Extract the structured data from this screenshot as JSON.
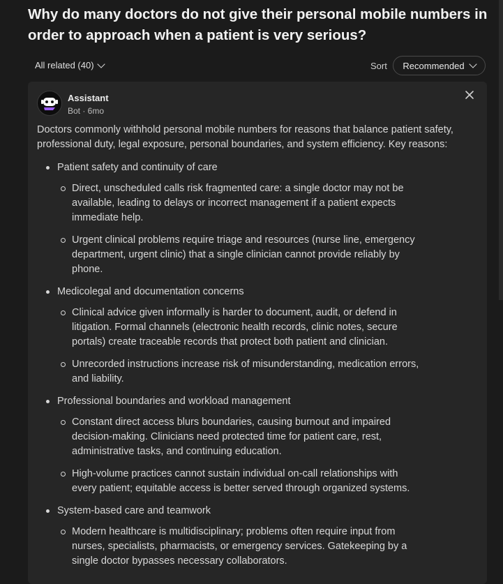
{
  "question": {
    "title": "Why do many doctors do not give their personal mobile numbers in order to approach when a patient is very serious?"
  },
  "filter": {
    "all_related_label": "All related (40)",
    "sort_label": "Sort",
    "sort_value": "Recommended"
  },
  "answer": {
    "author": "Assistant",
    "meta": "Bot · 6mo",
    "intro": "Doctors commonly withhold personal mobile numbers for reasons that balance patient safety, professional duty, legal exposure, personal boundaries, and system efficiency. Key reasons:",
    "sections": [
      {
        "title": "Patient safety and continuity of care",
        "points": [
          "Direct, unscheduled calls risk fragmented care: a single doctor may not be available, leading to delays or incorrect management if a patient expects immediate help.",
          "Urgent clinical problems require triage and resources (nurse line, emergency department, urgent clinic) that a single clinician cannot provide reliably by phone."
        ]
      },
      {
        "title": "Medicolegal and documentation concerns",
        "points": [
          "Clinical advice given informally is harder to document, audit, or defend in litigation. Formal channels (electronic health records, clinic notes, secure portals) create traceable records that protect both patient and clinician.",
          "Unrecorded instructions increase risk of misunderstanding, medication errors, and liability."
        ]
      },
      {
        "title": "Professional boundaries and workload management",
        "points": [
          "Constant direct access blurs boundaries, causing burnout and impaired decision-making. Clinicians need protected time for patient care, rest, administrative tasks, and continuing education.",
          "High-volume practices cannot sustain individual on-call relationships with every patient; equitable access is better served through organized systems."
        ]
      },
      {
        "title": "System-based care and teamwork",
        "points": [
          "Modern healthcare is multidisciplinary; problems often require input from nurses, specialists, pharmacists, or emergency services. Gatekeeping by a single doctor bypasses necessary collaborators."
        ]
      }
    ]
  },
  "icons": {
    "avatar": "robot-avatar-icon",
    "close": "close-icon",
    "dropdown": "chevron-down-icon"
  },
  "colors": {
    "background": "#1b1b1b",
    "card": "#262626",
    "avatar_accent": "#9b5cf6"
  }
}
